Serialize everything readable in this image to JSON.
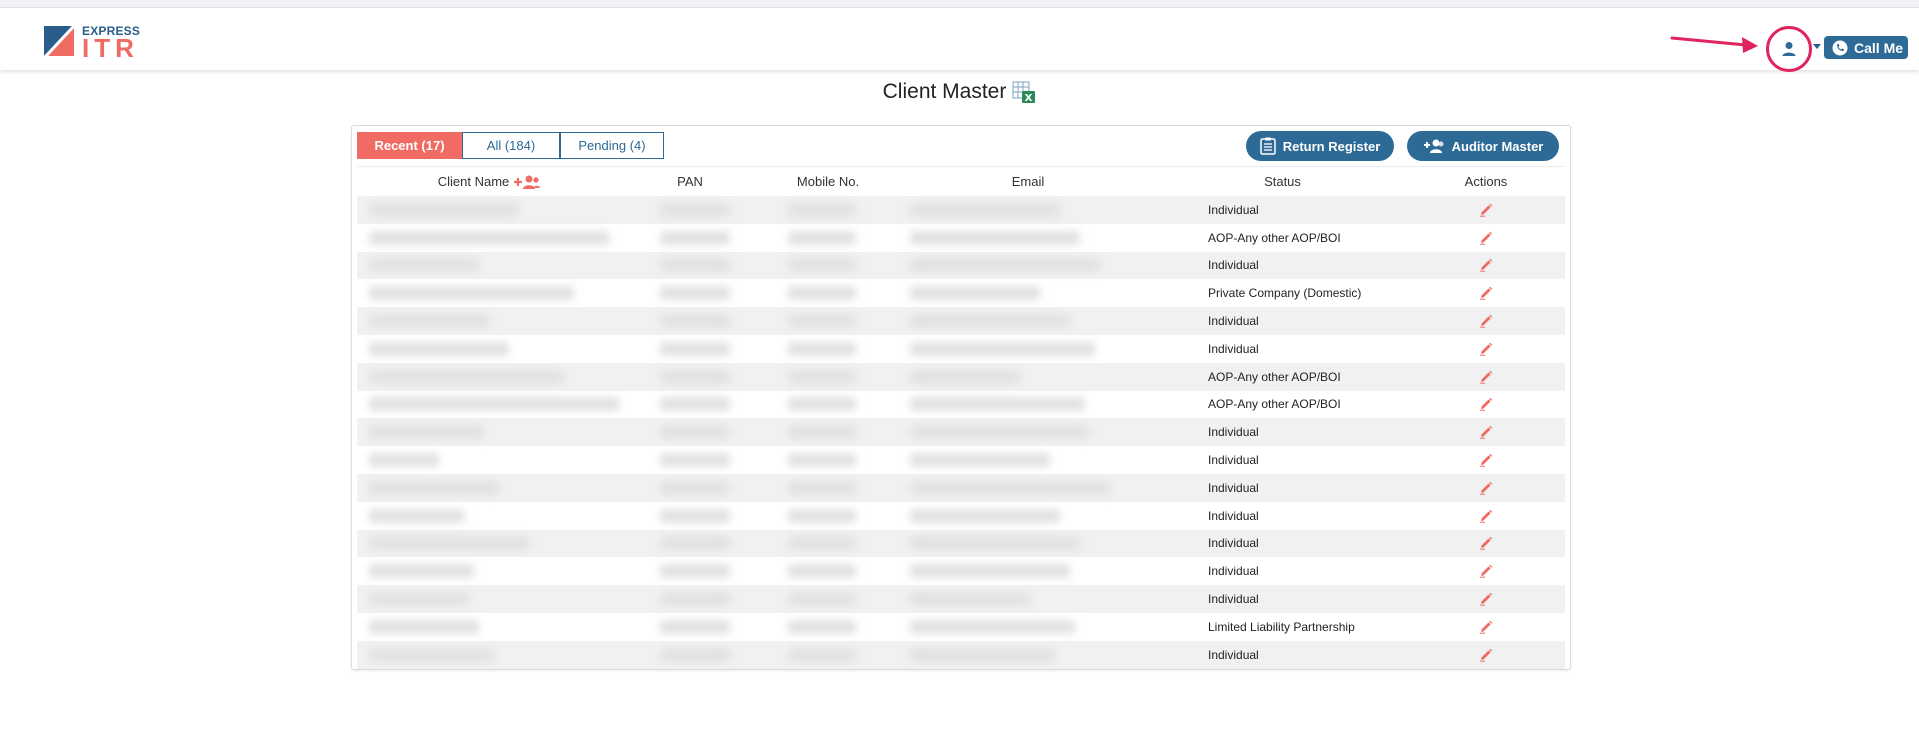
{
  "app": {
    "logo_top": "EXPRESS",
    "logo_bottom": "ITR"
  },
  "header": {
    "call_me_label": "Call Me"
  },
  "page": {
    "title": "Client Master"
  },
  "tabs": [
    {
      "label": "Recent (17)",
      "active": true
    },
    {
      "label": "All (184)",
      "active": false
    },
    {
      "label": "Pending (4)",
      "active": false
    }
  ],
  "actions": {
    "return_register_label": "Return Register",
    "auditor_master_label": "Auditor Master"
  },
  "table": {
    "columns": [
      "Client Name",
      "PAN",
      "Mobile No.",
      "Email",
      "Status",
      "Actions"
    ],
    "rows": [
      {
        "status": "Individual"
      },
      {
        "status": "AOP-Any other AOP/BOI"
      },
      {
        "status": "Individual"
      },
      {
        "status": "Private Company (Domestic)"
      },
      {
        "status": "Individual"
      },
      {
        "status": "Individual"
      },
      {
        "status": "AOP-Any other AOP/BOI"
      },
      {
        "status": "AOP-Any other AOP/BOI"
      },
      {
        "status": "Individual"
      },
      {
        "status": "Individual"
      },
      {
        "status": "Individual"
      },
      {
        "status": "Individual"
      },
      {
        "status": "Individual"
      },
      {
        "status": "Individual"
      },
      {
        "status": "Individual"
      },
      {
        "status": "Limited Liability Partnership"
      },
      {
        "status": "Individual"
      }
    ]
  },
  "colors": {
    "primary": "#2d6a96",
    "accent": "#ef6b63",
    "highlight_circle": "#e0245e"
  },
  "icons": {
    "user": "user-icon",
    "phone": "phone-icon",
    "excel": "excel-export-icon",
    "add_client": "add-client-icon",
    "clipboard": "clipboard-icon",
    "auditor": "add-users-icon",
    "edit": "pencil-icon"
  }
}
